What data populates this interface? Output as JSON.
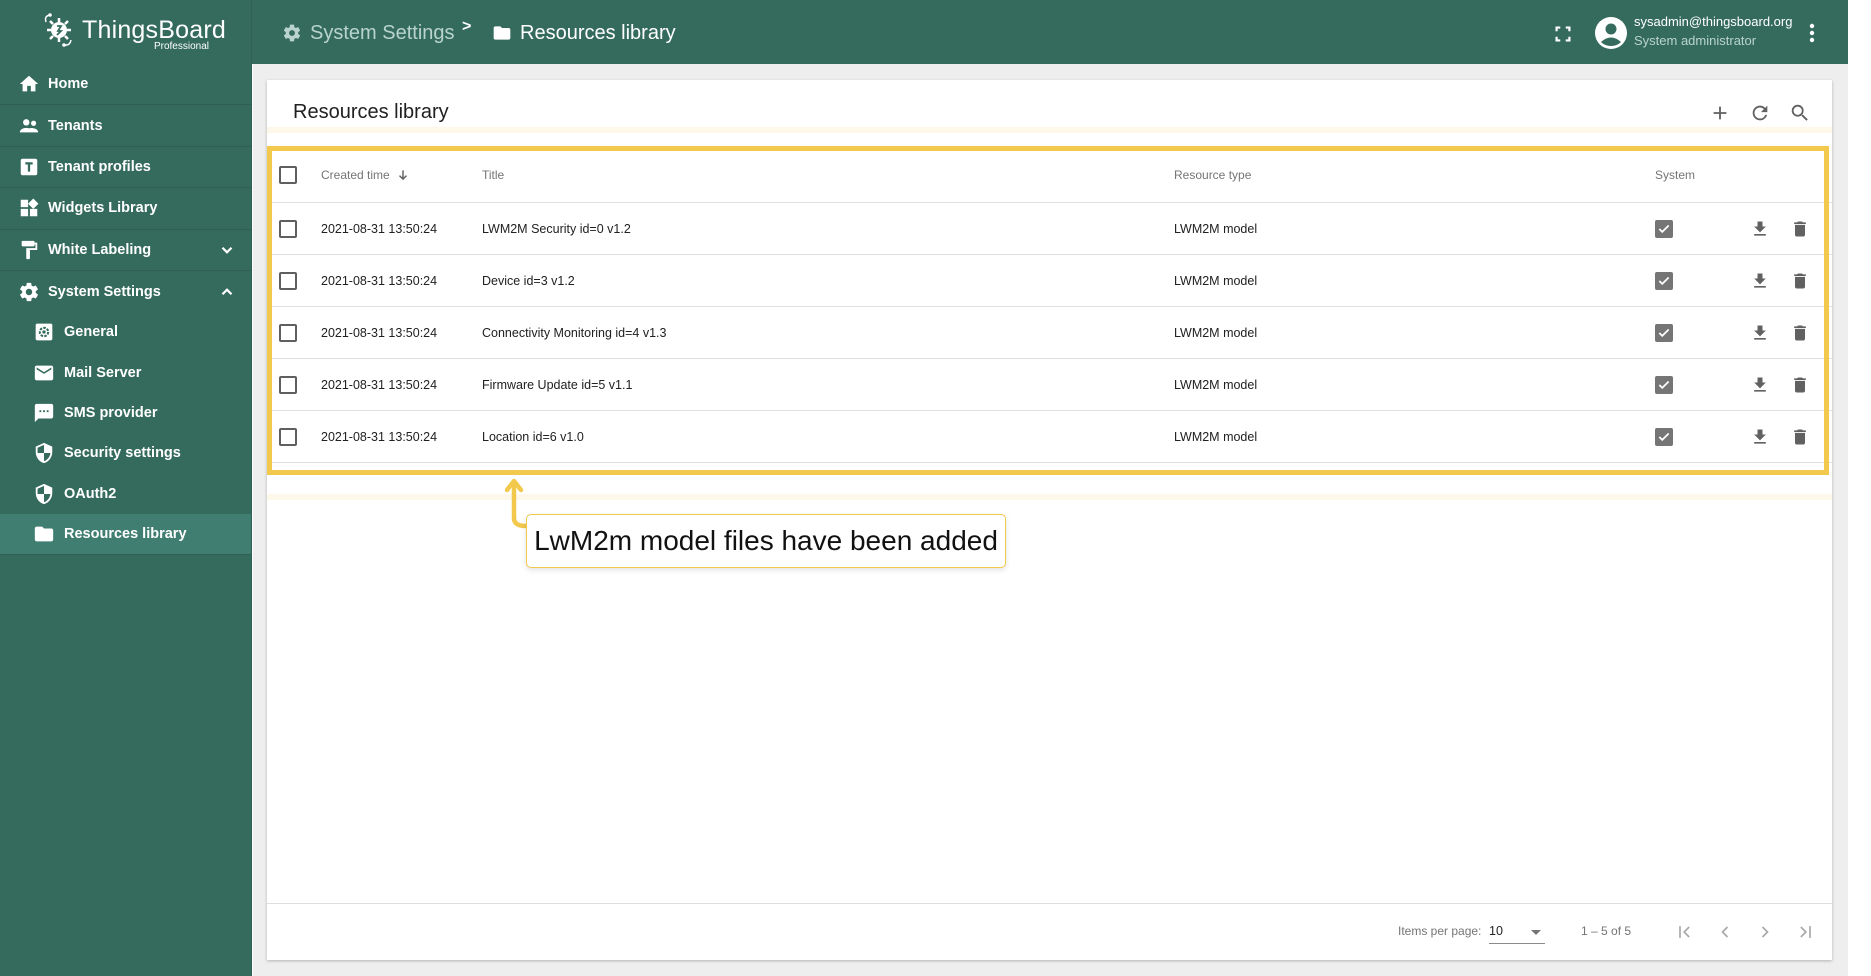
{
  "app": {
    "logo_text": "ThingsBoard",
    "logo_subtext": "Professional",
    "brand_color": "#356b5d",
    "highlight_color": "#f2c94c"
  },
  "breadcrumb": {
    "items": [
      {
        "icon": "gear-icon",
        "label": "System Settings"
      },
      {
        "icon": "folder-icon",
        "label": "Resources library"
      }
    ],
    "separator": ">"
  },
  "user": {
    "email": "sysadmin@thingsboard.org",
    "role": "System administrator"
  },
  "sidebar": {
    "items": [
      {
        "icon": "home-icon",
        "label": "Home"
      },
      {
        "icon": "tenants-icon",
        "label": "Tenants"
      },
      {
        "icon": "tenant-profiles-icon",
        "label": "Tenant profiles"
      },
      {
        "icon": "widgets-icon",
        "label": "Widgets Library"
      },
      {
        "icon": "paint-roller-icon",
        "label": "White Labeling",
        "expand": "chevron-down-icon"
      },
      {
        "icon": "gear-icon",
        "label": "System Settings",
        "expand": "chevron-up-icon"
      }
    ],
    "sub_items": [
      {
        "icon": "settings-box-icon",
        "label": "General"
      },
      {
        "icon": "mail-icon",
        "label": "Mail Server"
      },
      {
        "icon": "sms-icon",
        "label": "SMS provider"
      },
      {
        "icon": "shield-icon",
        "label": "Security settings"
      },
      {
        "icon": "shield-icon",
        "label": "OAuth2"
      },
      {
        "icon": "folder-icon",
        "label": "Resources library",
        "active": true
      }
    ]
  },
  "card": {
    "title": "Resources library",
    "toolbar": [
      "add-icon",
      "refresh-icon",
      "search-icon"
    ]
  },
  "table": {
    "columns": {
      "created_time": "Created time",
      "title": "Title",
      "resource_type": "Resource type",
      "system": "System"
    },
    "sort": {
      "column": "created_time",
      "direction": "desc"
    },
    "rows": [
      {
        "created_time": "2021-08-31 13:50:24",
        "title": "LWM2M Security id=0 v1.2",
        "resource_type": "LWM2M model",
        "system": true
      },
      {
        "created_time": "2021-08-31 13:50:24",
        "title": "Device id=3 v1.2",
        "resource_type": "LWM2M model",
        "system": true
      },
      {
        "created_time": "2021-08-31 13:50:24",
        "title": "Connectivity Monitoring id=4 v1.3",
        "resource_type": "LWM2M model",
        "system": true
      },
      {
        "created_time": "2021-08-31 13:50:24",
        "title": "Firmware Update id=5 v1.1",
        "resource_type": "LWM2M model",
        "system": true
      },
      {
        "created_time": "2021-08-31 13:50:24",
        "title": "Location id=6 v1.0",
        "resource_type": "LWM2M model",
        "system": true
      }
    ]
  },
  "paginator": {
    "items_per_page_label": "Items per page:",
    "items_per_page": "10",
    "range": "1 – 5 of 5"
  },
  "annotation": {
    "text": "LwM2m model files have been added"
  }
}
